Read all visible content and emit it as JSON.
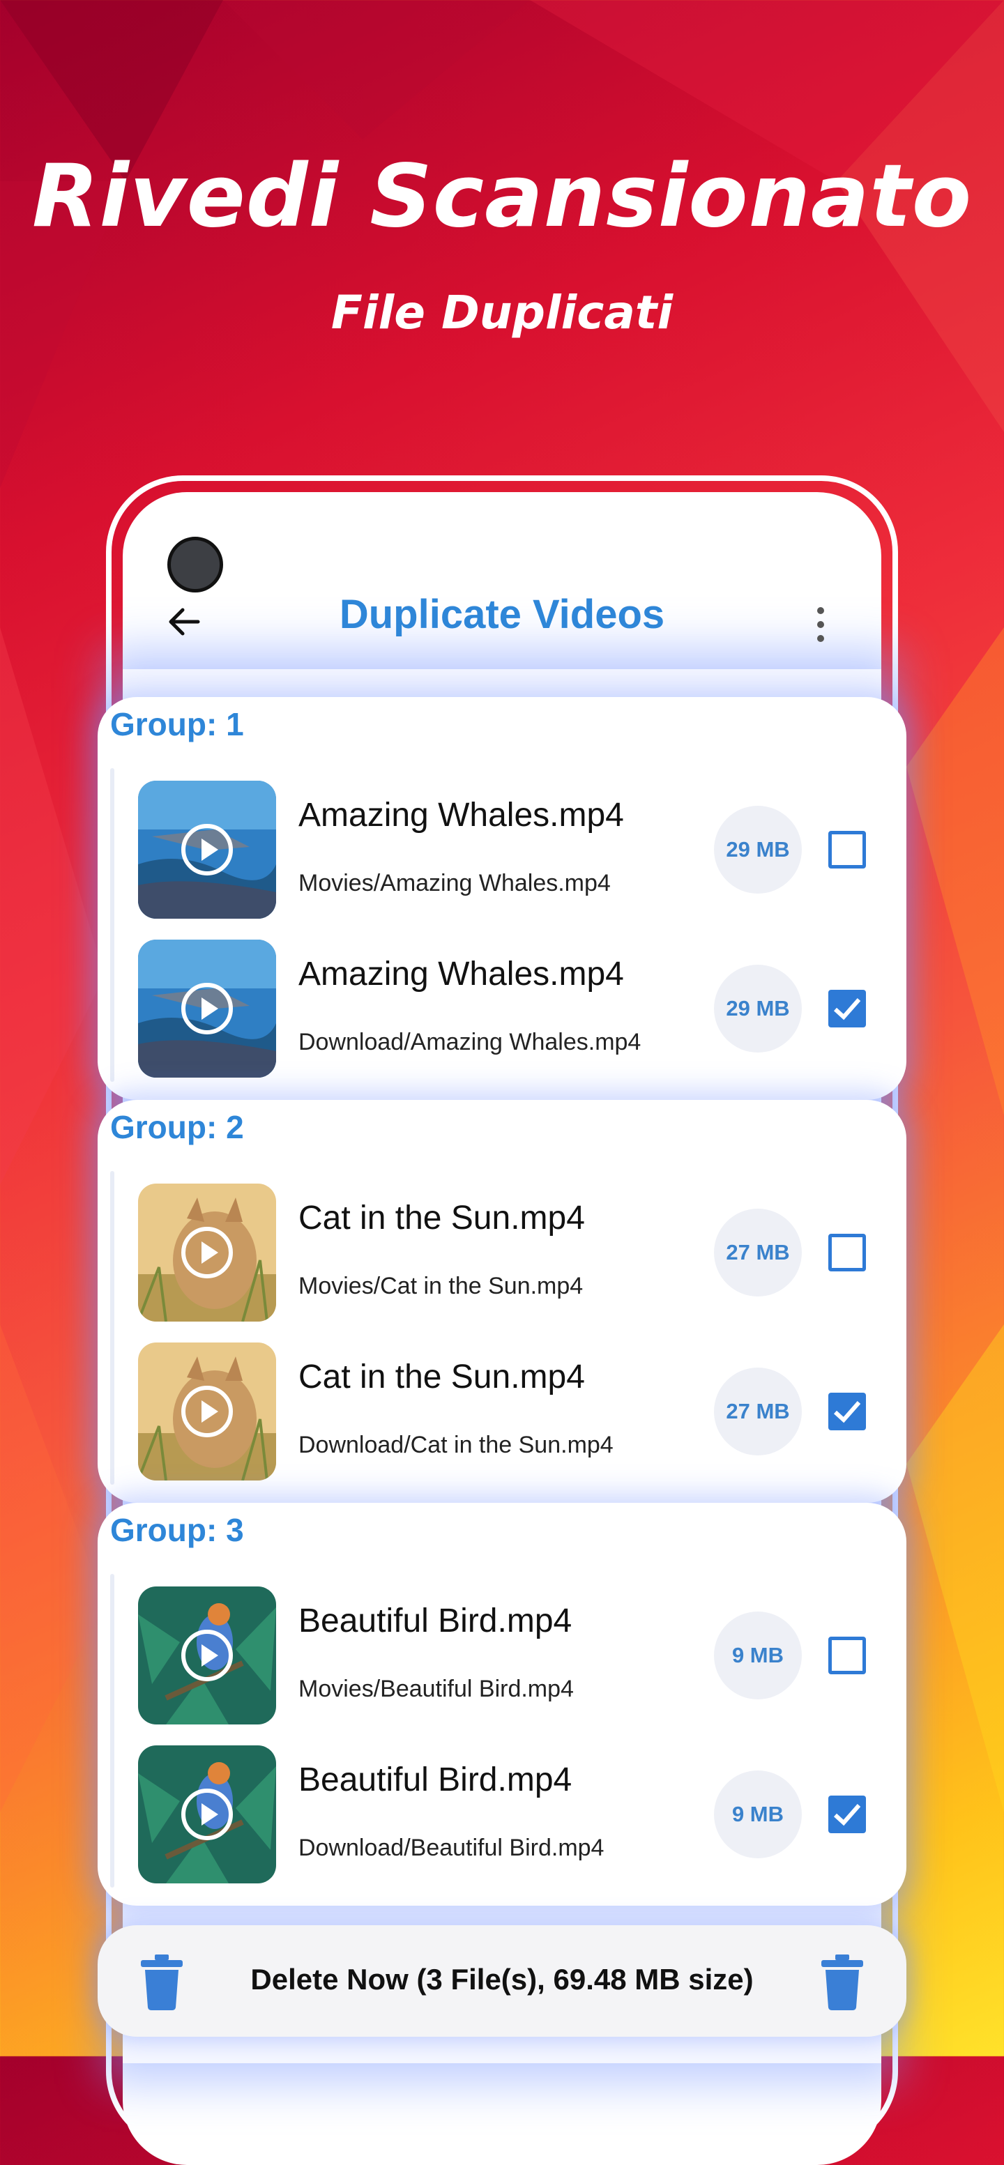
{
  "hero": {
    "title": "Rivedi Scansionato",
    "subtitle": "File Duplicati"
  },
  "app_bar": {
    "title": "Duplicate Videos",
    "back_icon": "arrow-left-icon",
    "menu_icon": "more-vertical-icon"
  },
  "groups": [
    {
      "label": "Group: 1",
      "items": [
        {
          "name": "Amazing Whales.mp4",
          "path": "Movies/Amazing Whales.mp4",
          "size": "29 MB",
          "checked": false
        },
        {
          "name": "Amazing Whales.mp4",
          "path": "Download/Amazing Whales.mp4",
          "size": "29 MB",
          "checked": true
        }
      ]
    },
    {
      "label": "Group: 2",
      "items": [
        {
          "name": "Cat in the Sun.mp4",
          "path": "Movies/Cat in the Sun.mp4",
          "size": "27 MB",
          "checked": false
        },
        {
          "name": "Cat in the Sun.mp4",
          "path": "Download/Cat in the Sun.mp4",
          "size": "27 MB",
          "checked": true
        }
      ]
    },
    {
      "label": "Group: 3",
      "items": [
        {
          "name": "Beautiful Bird.mp4",
          "path": "Movies/Beautiful Bird.mp4",
          "size": "9 MB",
          "checked": false
        },
        {
          "name": "Beautiful Bird.mp4",
          "path": "Download/Beautiful Bird.mp4",
          "size": "9 MB",
          "checked": true
        }
      ]
    }
  ],
  "bottom_bar": {
    "delete_label": "Delete Now (3 File(s), 69.48 MB size)"
  },
  "colors": {
    "accent": "#2e86d8",
    "checkbox": "#2e7ad6"
  }
}
